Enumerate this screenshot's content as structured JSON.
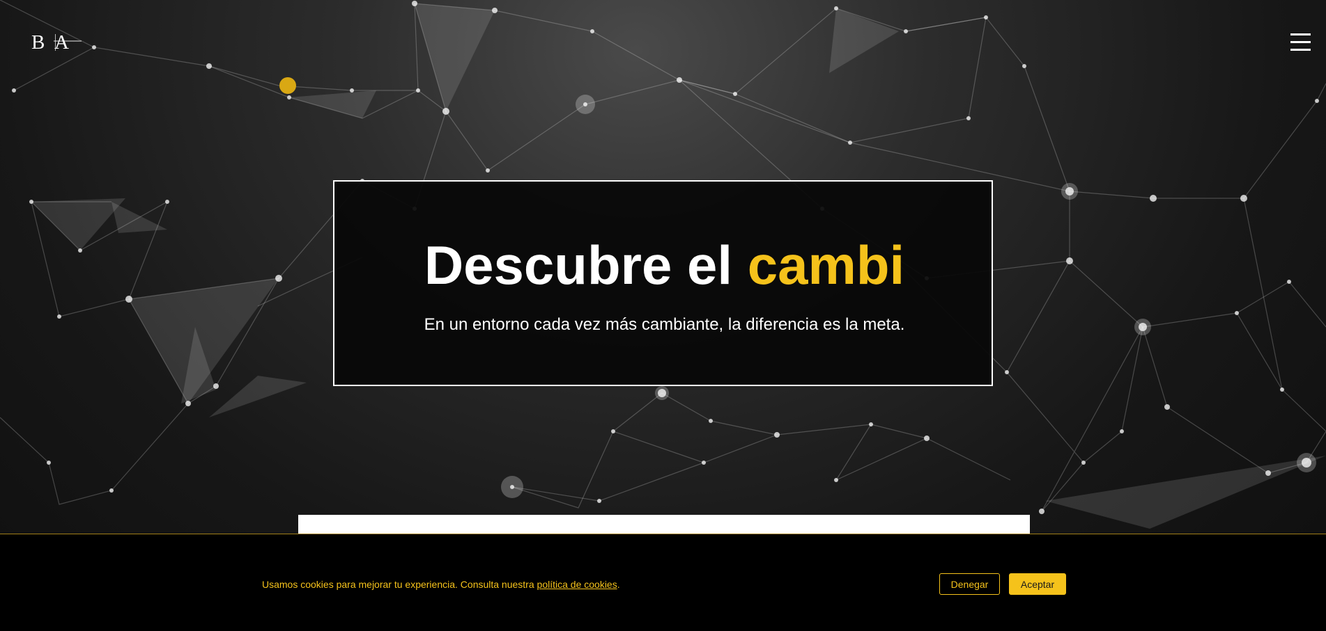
{
  "header": {
    "logo_text": "B A",
    "menu_icon": "hamburger-menu-icon"
  },
  "hero": {
    "title_main": "Descubre el ",
    "title_accent": "cambi",
    "subtitle": "En un entorno cada vez más cambiante, la diferencia es la meta."
  },
  "cookie_banner": {
    "text": "Usamos cookies para mejorar tu experiencia. Consulta nuestra ",
    "link_text": "política de cookies",
    "text_end": ".",
    "deny_label": "Denegar",
    "accept_label": "Aceptar"
  },
  "colors": {
    "accent": "#f5c21b",
    "background": "#1b1b1b",
    "cookie_background": "#000000",
    "dot": "#d9a814"
  }
}
